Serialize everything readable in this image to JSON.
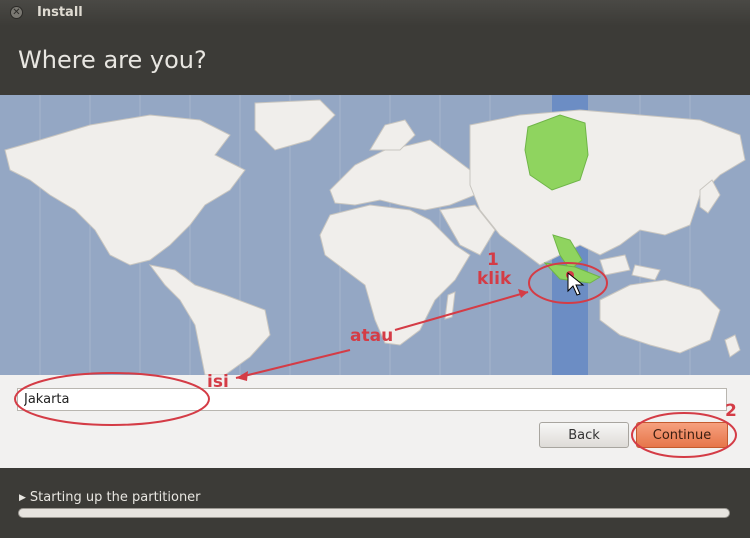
{
  "window": {
    "title": "Install",
    "close_icon": "close-icon"
  },
  "header": {
    "heading": "Where are you?"
  },
  "location": {
    "value": "Jakarta",
    "placeholder": ""
  },
  "buttons": {
    "back": "Back",
    "continue": "Continue"
  },
  "footer": {
    "status": "Starting up the partitioner",
    "progress": 0.0
  },
  "annotations": {
    "step1_number": "1",
    "step1_text": "klik",
    "or_text": "atau",
    "fill_text": "isi",
    "step2_number": "2"
  },
  "colors": {
    "ocean": "#94a7c4",
    "land": "#f0eeeb",
    "highlight_land": "#8fd45f",
    "timezone_band": "#6c8dc4",
    "annotation": "#d43c46",
    "continue_button": "#e6764a"
  }
}
